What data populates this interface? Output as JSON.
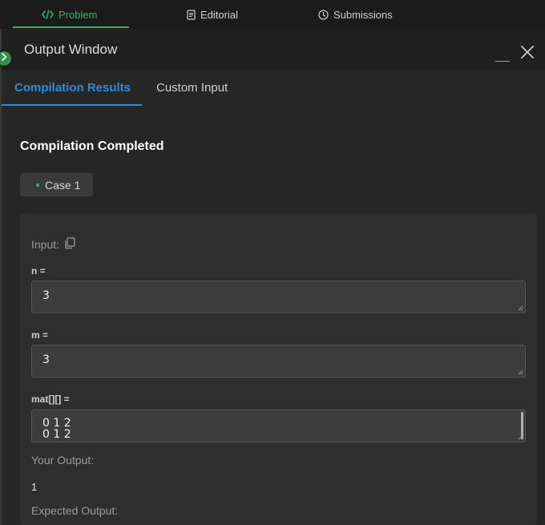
{
  "top_tabs": {
    "problem": "Problem",
    "editorial": "Editorial",
    "submissions": "Submissions"
  },
  "output_window": {
    "title": "Output Window",
    "tabs": {
      "compilation_results": "Compilation Results",
      "custom_input": "Custom Input"
    },
    "status": "Compilation Completed",
    "case_label": "Case 1",
    "input_label": "Input:",
    "variables": {
      "n": {
        "label": "n =",
        "value": "3"
      },
      "m": {
        "label": "m =",
        "value": "3"
      },
      "mat": {
        "label": "mat[][] =",
        "line1": "0 1 2",
        "line2": "0 1 2"
      }
    },
    "your_output_label": "Your Output:",
    "your_output_value": "1",
    "expected_output_label": "Expected Output:"
  },
  "colors": {
    "accent_green": "#2fb36d",
    "accent_blue": "#2d8ce0",
    "background": "#262626"
  },
  "icons": {
    "problem": "code-icon",
    "editorial": "document-icon",
    "submissions": "clock-icon",
    "copy": "copy-icon",
    "close": "close-icon",
    "minimize": "minimize-icon",
    "expand": "chevron-right-icon"
  }
}
